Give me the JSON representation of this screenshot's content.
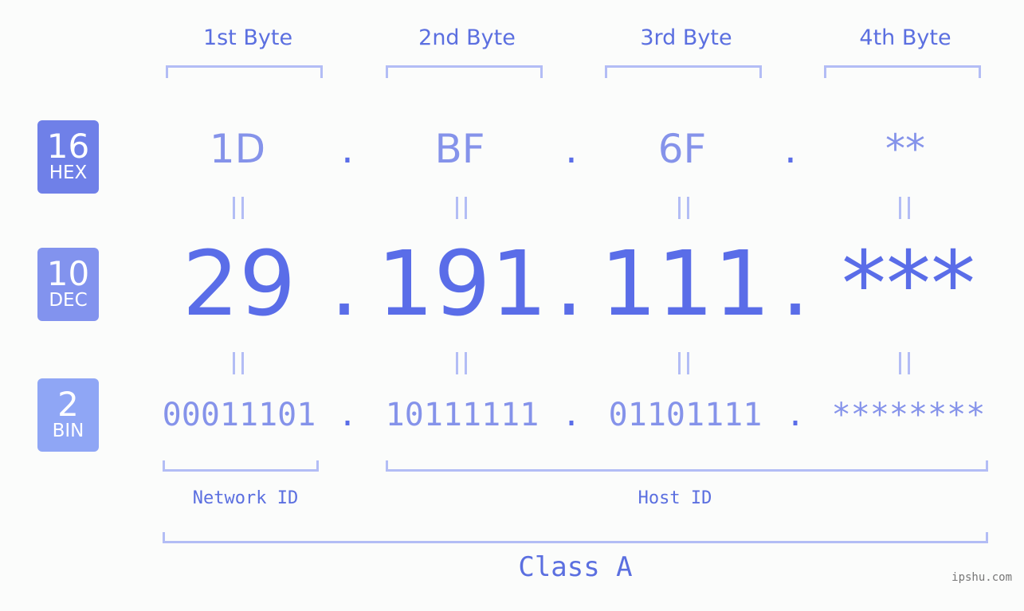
{
  "byte_headers": [
    "1st Byte",
    "2nd Byte",
    "3rd Byte",
    "4th Byte"
  ],
  "rows": {
    "hex": {
      "base": "16",
      "label": "HEX",
      "color": "#6f80e8",
      "values": [
        "1D",
        "BF",
        "6F",
        "**"
      ]
    },
    "dec": {
      "base": "10",
      "label": "DEC",
      "color": "#8293ee",
      "values": [
        "29",
        "191",
        "111",
        "***"
      ]
    },
    "bin": {
      "base": "2",
      "label": "BIN",
      "color": "#8fa6f5",
      "values": [
        "00011101",
        "10111111",
        "01101111",
        "********"
      ]
    }
  },
  "separator": ".",
  "network_id_label": "Network ID",
  "host_id_label": "Host ID",
  "class_label": "Class A",
  "watermark": "ipshu.com"
}
